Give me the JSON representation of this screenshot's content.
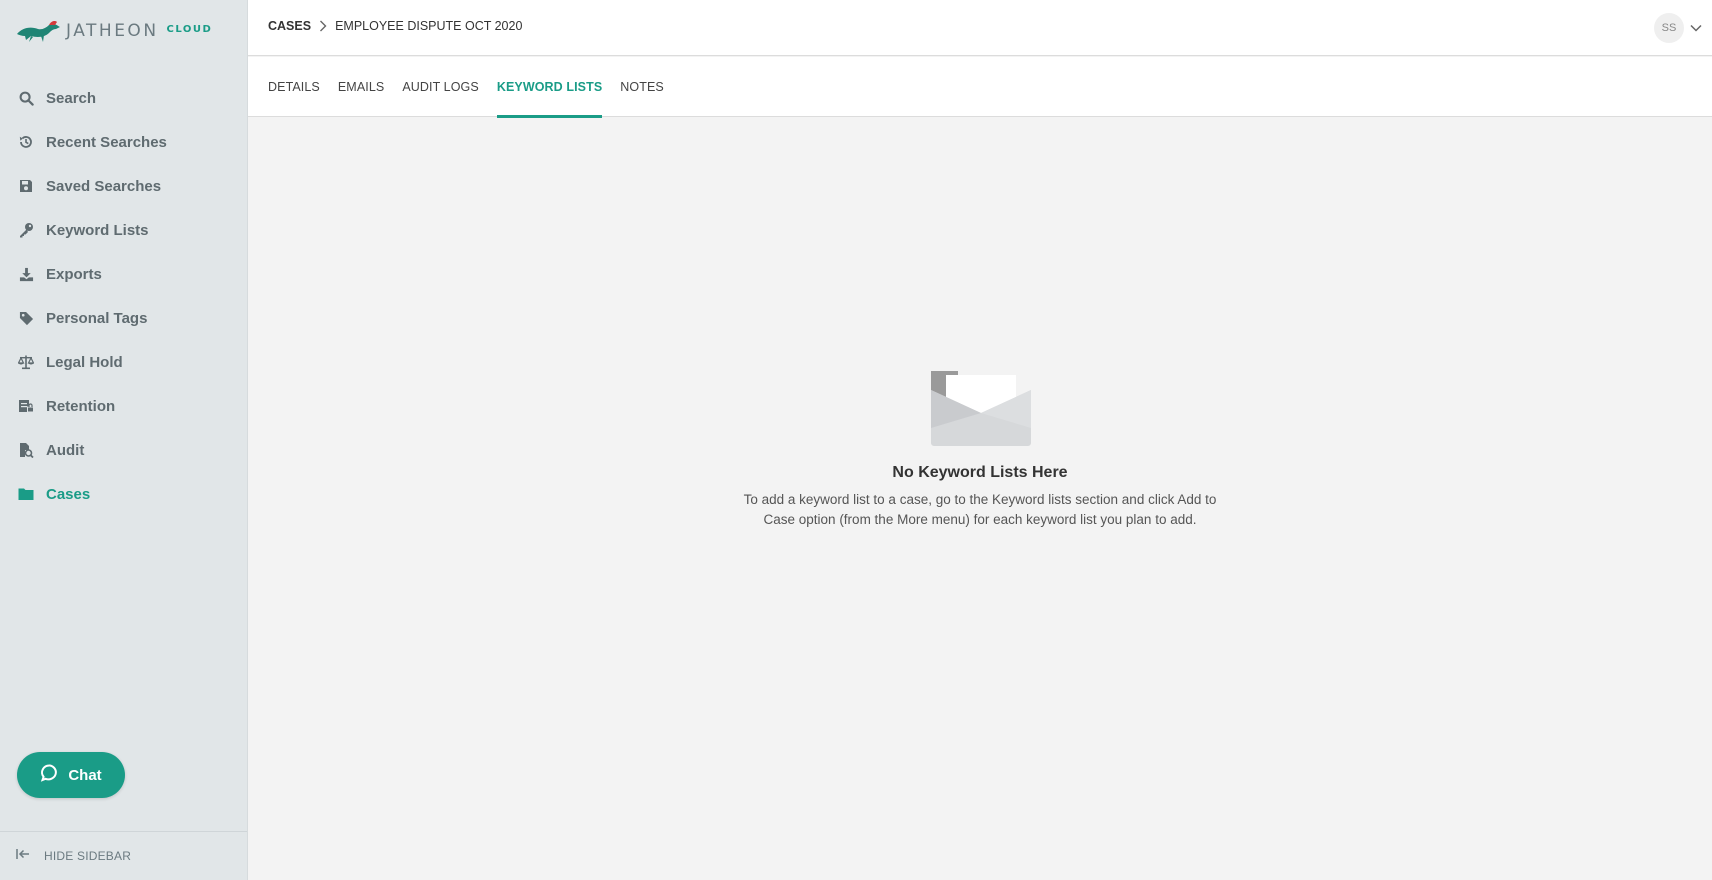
{
  "brand": {
    "name": "JATHEON",
    "suffix": "CLOUD"
  },
  "sidebar": {
    "items": [
      {
        "label": "Search",
        "icon": "search-icon"
      },
      {
        "label": "Recent Searches",
        "icon": "history-icon"
      },
      {
        "label": "Saved Searches",
        "icon": "floppy-disk-icon"
      },
      {
        "label": "Keyword Lists",
        "icon": "key-icon"
      },
      {
        "label": "Exports",
        "icon": "download-icon"
      },
      {
        "label": "Personal Tags",
        "icon": "tag-icon"
      },
      {
        "label": "Legal Hold",
        "icon": "balance-scale-icon"
      },
      {
        "label": "Retention",
        "icon": "retention-icon"
      },
      {
        "label": "Audit",
        "icon": "audit-document-icon"
      },
      {
        "label": "Cases",
        "icon": "folder-icon",
        "active": true
      }
    ],
    "chat_label": "Chat",
    "hide_label": "HIDE SIDEBAR"
  },
  "header": {
    "breadcrumb_root": "CASES",
    "breadcrumb_current": "EMPLOYEE DISPUTE OCT 2020",
    "user_initials": "SS"
  },
  "tabs": [
    {
      "label": "DETAILS"
    },
    {
      "label": "EMAILS"
    },
    {
      "label": "AUDIT LOGS"
    },
    {
      "label": "KEYWORD LISTS",
      "active": true
    },
    {
      "label": "NOTES"
    }
  ],
  "empty_state": {
    "icon": "open-envelope-icon",
    "title": "No Keyword Lists Here",
    "description": "To add a keyword list to a case, go to the Keyword lists section and click Add to Case option (from the More menu) for each keyword list you plan to add."
  },
  "colors": {
    "accent": "#1a9c87",
    "sidebar_bg": "#e1e6e8",
    "sidebar_text": "#5f6b70",
    "content_bg": "#f3f3f3"
  }
}
